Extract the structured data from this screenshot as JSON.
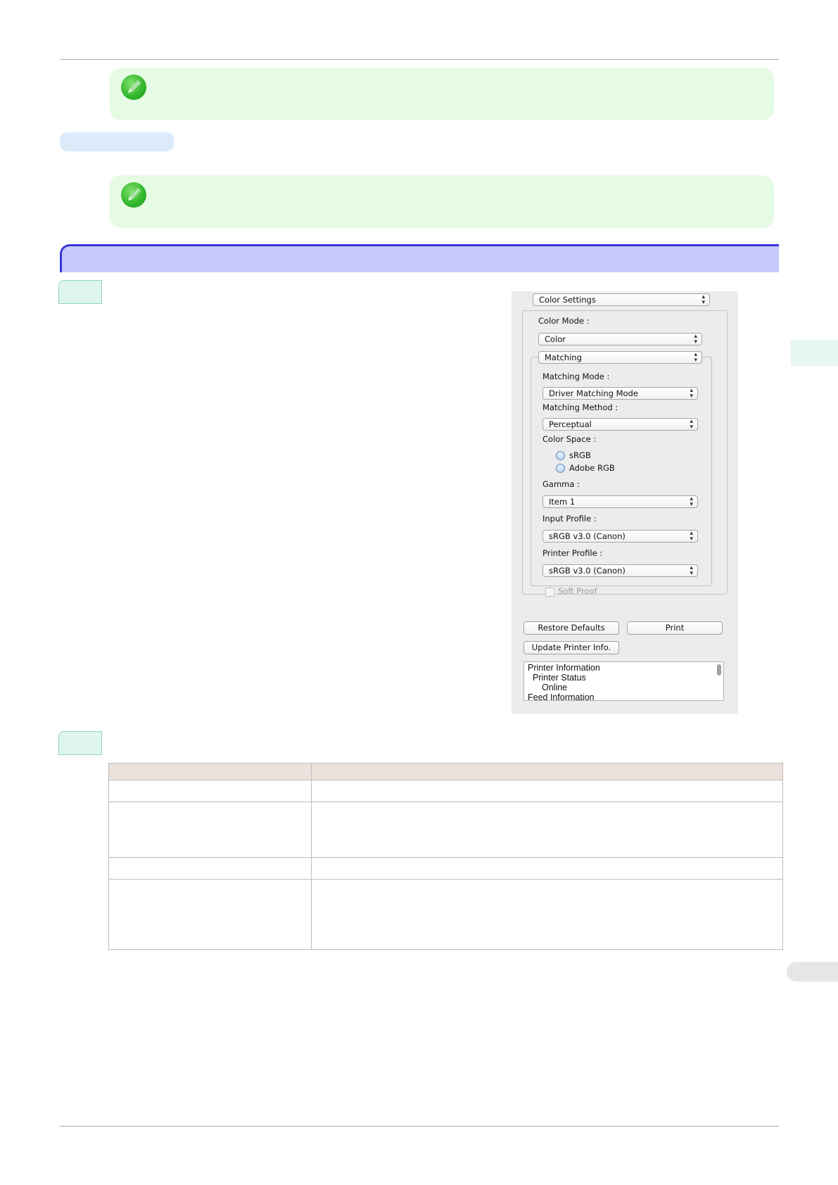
{
  "dialog": {
    "section_popup": "Color Settings",
    "color_mode_label": "Color Mode :",
    "color_mode_value": "Color",
    "matching_popup": "Matching",
    "matching_mode_label": "Matching Mode :",
    "matching_mode_value": "Driver Matching Mode",
    "matching_method_label": "Matching Method :",
    "matching_method_value": "Perceptual",
    "color_space_label": "Color Space :",
    "color_space_options": [
      "sRGB",
      "Adobe RGB"
    ],
    "gamma_label": "Gamma :",
    "gamma_value": "Item 1",
    "input_profile_label": "Input Profile :",
    "input_profile_value": "sRGB v3.0 (Canon)",
    "printer_profile_label": "Printer Profile :",
    "printer_profile_value": "sRGB v3.0 (Canon)",
    "soft_proof_label": "Soft Proof",
    "restore_defaults_label": "Restore Defaults",
    "print_label": "Print",
    "update_printer_info_label": "Update Printer Info.",
    "printer_info_lines": [
      "Printer Information",
      "Printer Status",
      "Online",
      "Feed Information"
    ]
  },
  "colors": {
    "note_background": "#e6fbe3",
    "section_bar": "#c8c8fb",
    "section_border": "#3838d8",
    "step_badge": "#dff5f0"
  },
  "icons": {
    "note": "pencil-note-icon"
  }
}
